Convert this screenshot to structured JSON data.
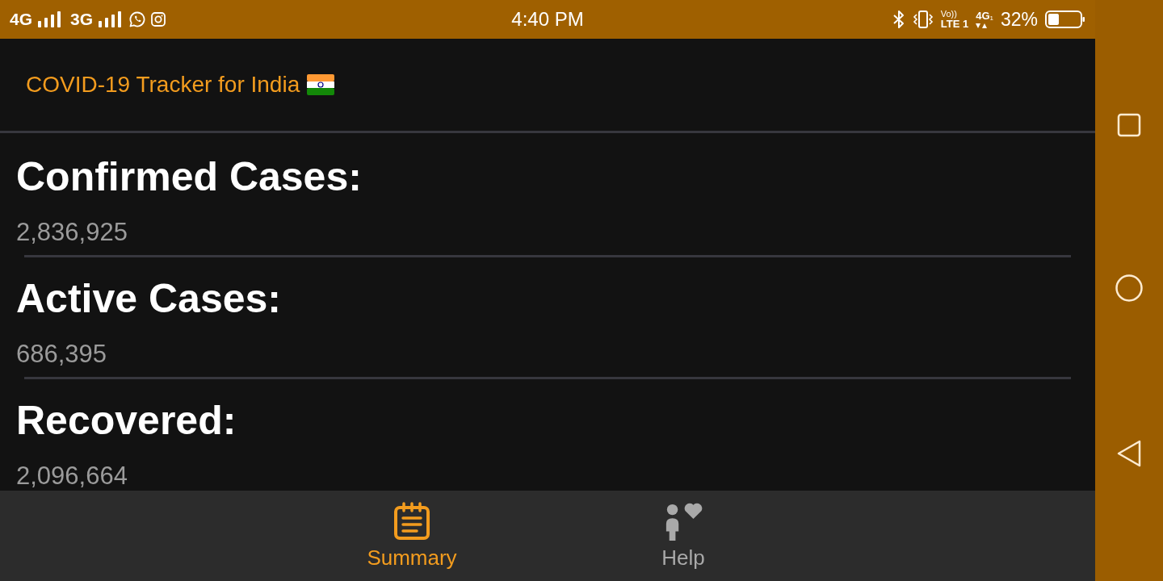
{
  "status_bar": {
    "networks": [
      "4G",
      "3G"
    ],
    "time": "4:40 PM",
    "volte": [
      "Vo))",
      "LTE 1"
    ],
    "data_network": {
      "label": "4G",
      "sim": "1"
    },
    "battery": "32%"
  },
  "app_bar": {
    "title": "COVID-19 Tracker for India"
  },
  "stats": [
    {
      "label": "Confirmed Cases:",
      "value": "2,836,925"
    },
    {
      "label": "Active Cases:",
      "value": "686,395"
    },
    {
      "label": "Recovered:",
      "value": "2,096,664"
    }
  ],
  "bottom_nav": [
    {
      "label": "Summary",
      "selected": true
    },
    {
      "label": "Help",
      "selected": false
    }
  ]
}
